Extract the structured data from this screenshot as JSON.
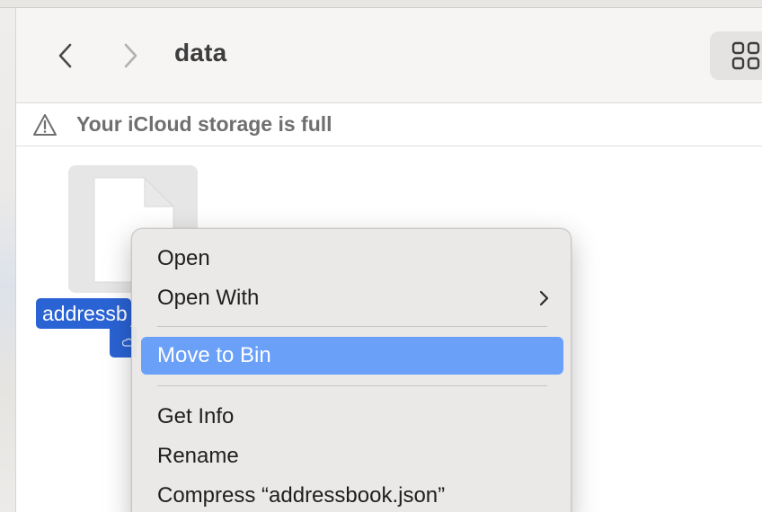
{
  "window": {
    "title": "data"
  },
  "toolbar": {
    "back_icon": "chevron-left-icon",
    "forward_icon": "chevron-right-icon",
    "view_icon": "grid-view-icon"
  },
  "banner": {
    "icon": "warning-triangle-icon",
    "text": "Your iCloud storage is full"
  },
  "file": {
    "name_visible": "addressb",
    "icon": "document-icon",
    "status_icon": "cloud-icon"
  },
  "context_menu": {
    "items": [
      {
        "label": "Open"
      },
      {
        "label": "Open With",
        "has_submenu": true
      },
      {
        "label": "Move to Bin",
        "highlighted": true
      },
      {
        "label": "Get Info"
      },
      {
        "label": "Rename"
      },
      {
        "label": "Compress “addressbook.json”"
      }
    ]
  },
  "colors": {
    "selection_blue": "#2a63d4",
    "menu_highlight": "#6aa0f7",
    "toolbar_bg": "#f6f5f4",
    "menu_bg": "#e9e8e7"
  }
}
